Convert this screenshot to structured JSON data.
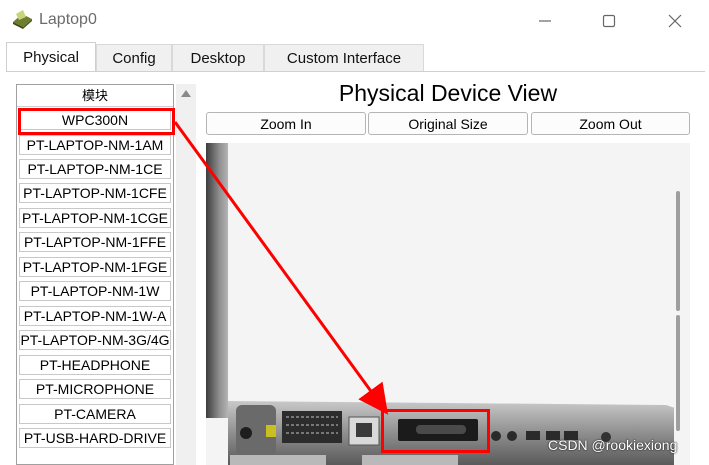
{
  "window": {
    "title": "Laptop0",
    "controls": {
      "minimize": "—",
      "maximize": "☐",
      "close": "✕"
    }
  },
  "tabs": [
    {
      "label": "Physical",
      "active": true
    },
    {
      "label": "Config",
      "active": false
    },
    {
      "label": "Desktop",
      "active": false
    },
    {
      "label": "Custom Interface",
      "active": false
    }
  ],
  "modules": {
    "header": "模块",
    "items": [
      "WPC300N",
      "PT-LAPTOP-NM-1AM",
      "PT-LAPTOP-NM-1CE",
      "PT-LAPTOP-NM-1CFE",
      "PT-LAPTOP-NM-1CGE",
      "PT-LAPTOP-NM-1FFE",
      "PT-LAPTOP-NM-1FGE",
      "PT-LAPTOP-NM-1W",
      "PT-LAPTOP-NM-1W-A",
      "PT-LAPTOP-NM-3G/4G",
      "PT-HEADPHONE",
      "PT-MICROPHONE",
      "PT-CAMERA",
      "PT-USB-HARD-DRIVE"
    ],
    "highlighted": "WPC300N"
  },
  "device_view": {
    "title": "Physical Device View",
    "zoom_in": "Zoom In",
    "original_size": "Original Size",
    "zoom_out": "Zoom Out"
  },
  "annotation": {
    "color": "#ff0000"
  },
  "watermark": "CSDN @rookiexiong"
}
